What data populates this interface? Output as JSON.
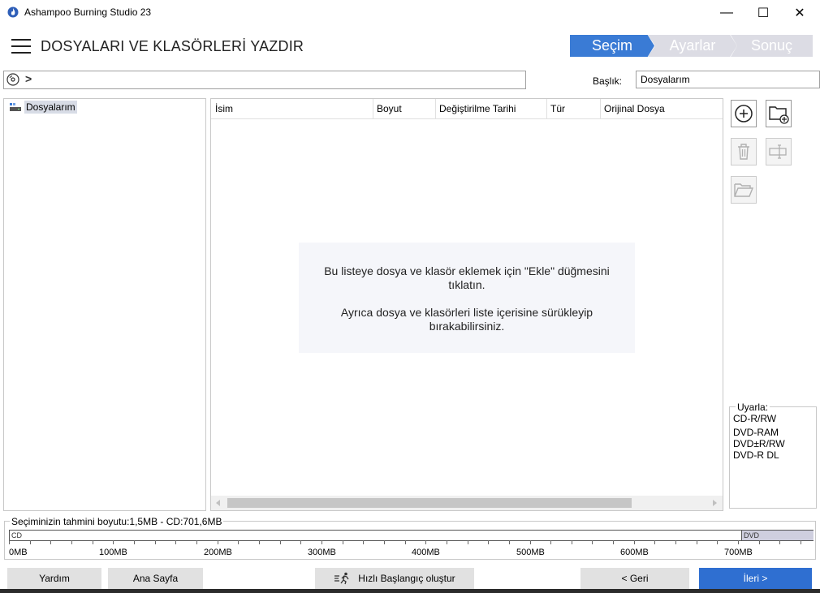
{
  "window": {
    "title": "Ashampoo Burning Studio 23",
    "minimize": "—",
    "maximize": "☐",
    "close": "✕"
  },
  "header": {
    "title": "DOSYALARI VE KLASÖRLERİ YAZDIR",
    "steps": [
      {
        "label": "Seçim",
        "active": true
      },
      {
        "label": "Ayarlar",
        "active": false
      },
      {
        "label": "Sonuç",
        "active": false
      }
    ]
  },
  "toolbar": {
    "title_label": "Başlık:",
    "title_value": "Dosyalarım"
  },
  "tree": {
    "root_label": "Dosyalarım"
  },
  "list": {
    "columns": [
      "İsim",
      "Boyut",
      "Değiştirilme Tarihi",
      "Tür",
      "Orijinal Dosya"
    ],
    "hint_line1": "Bu listeye dosya ve klasör eklemek için \"Ekle\" düğmesini tıklatın.",
    "hint_line2": "Ayrıca dosya ve klasörleri liste içerisine sürükleyip bırakabilirsiniz."
  },
  "warning": {
    "title": "Uyarla:",
    "items": [
      "CD-R/RW",
      "DVD-RAM",
      "DVD±R/RW",
      "DVD-R DL"
    ]
  },
  "size": {
    "label": "Seçiminizin tahmini boyutu:1,5MB - CD:701,6MB",
    "cd_label": "CD",
    "dvd_label": "DVD",
    "ticks": [
      "0MB",
      "100MB",
      "200MB",
      "300MB",
      "400MB",
      "500MB",
      "600MB",
      "700MB"
    ]
  },
  "buttons": {
    "help": "Yardım",
    "home": "Ana Sayfa",
    "quickstart": "Hızlı Başlangıç oluştur",
    "back": "< Geri",
    "next": "İleri >"
  },
  "colors": {
    "accent": "#3a7bd5",
    "step_inactive": "#dcdce4",
    "next_button": "#2f6fd1"
  }
}
